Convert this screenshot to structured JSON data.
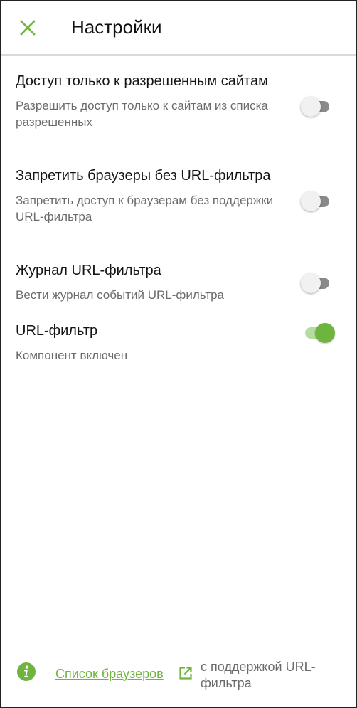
{
  "header": {
    "title": "Настройки",
    "close_icon": "close-icon"
  },
  "colors": {
    "accent": "#6fb43f",
    "switch_off_track": "#8a8a8a",
    "switch_on_track": "#b7dca0",
    "subtitle": "#6b6b6b"
  },
  "settings": [
    {
      "title": "Доступ только к разрешенным сайтам",
      "subtitle": "Разрешить доступ только к сайтам из списка разрешенных",
      "enabled": false
    },
    {
      "title": "Запретить браузеры без URL-фильтра",
      "subtitle": "Запретить доступ к браузерам без поддержки URL-фильтра",
      "enabled": false
    },
    {
      "title": "Журнал URL-фильтра",
      "subtitle": "Вести журнал событий URL-фильтра",
      "enabled": false
    },
    {
      "title": "URL-фильтр",
      "subtitle": "Компонент включен",
      "enabled": true
    }
  ],
  "footer": {
    "info_icon": "info-icon",
    "link_label": "Список браузеров",
    "external_icon": "external-link-icon",
    "text": "с поддержкой URL-фильтра"
  }
}
